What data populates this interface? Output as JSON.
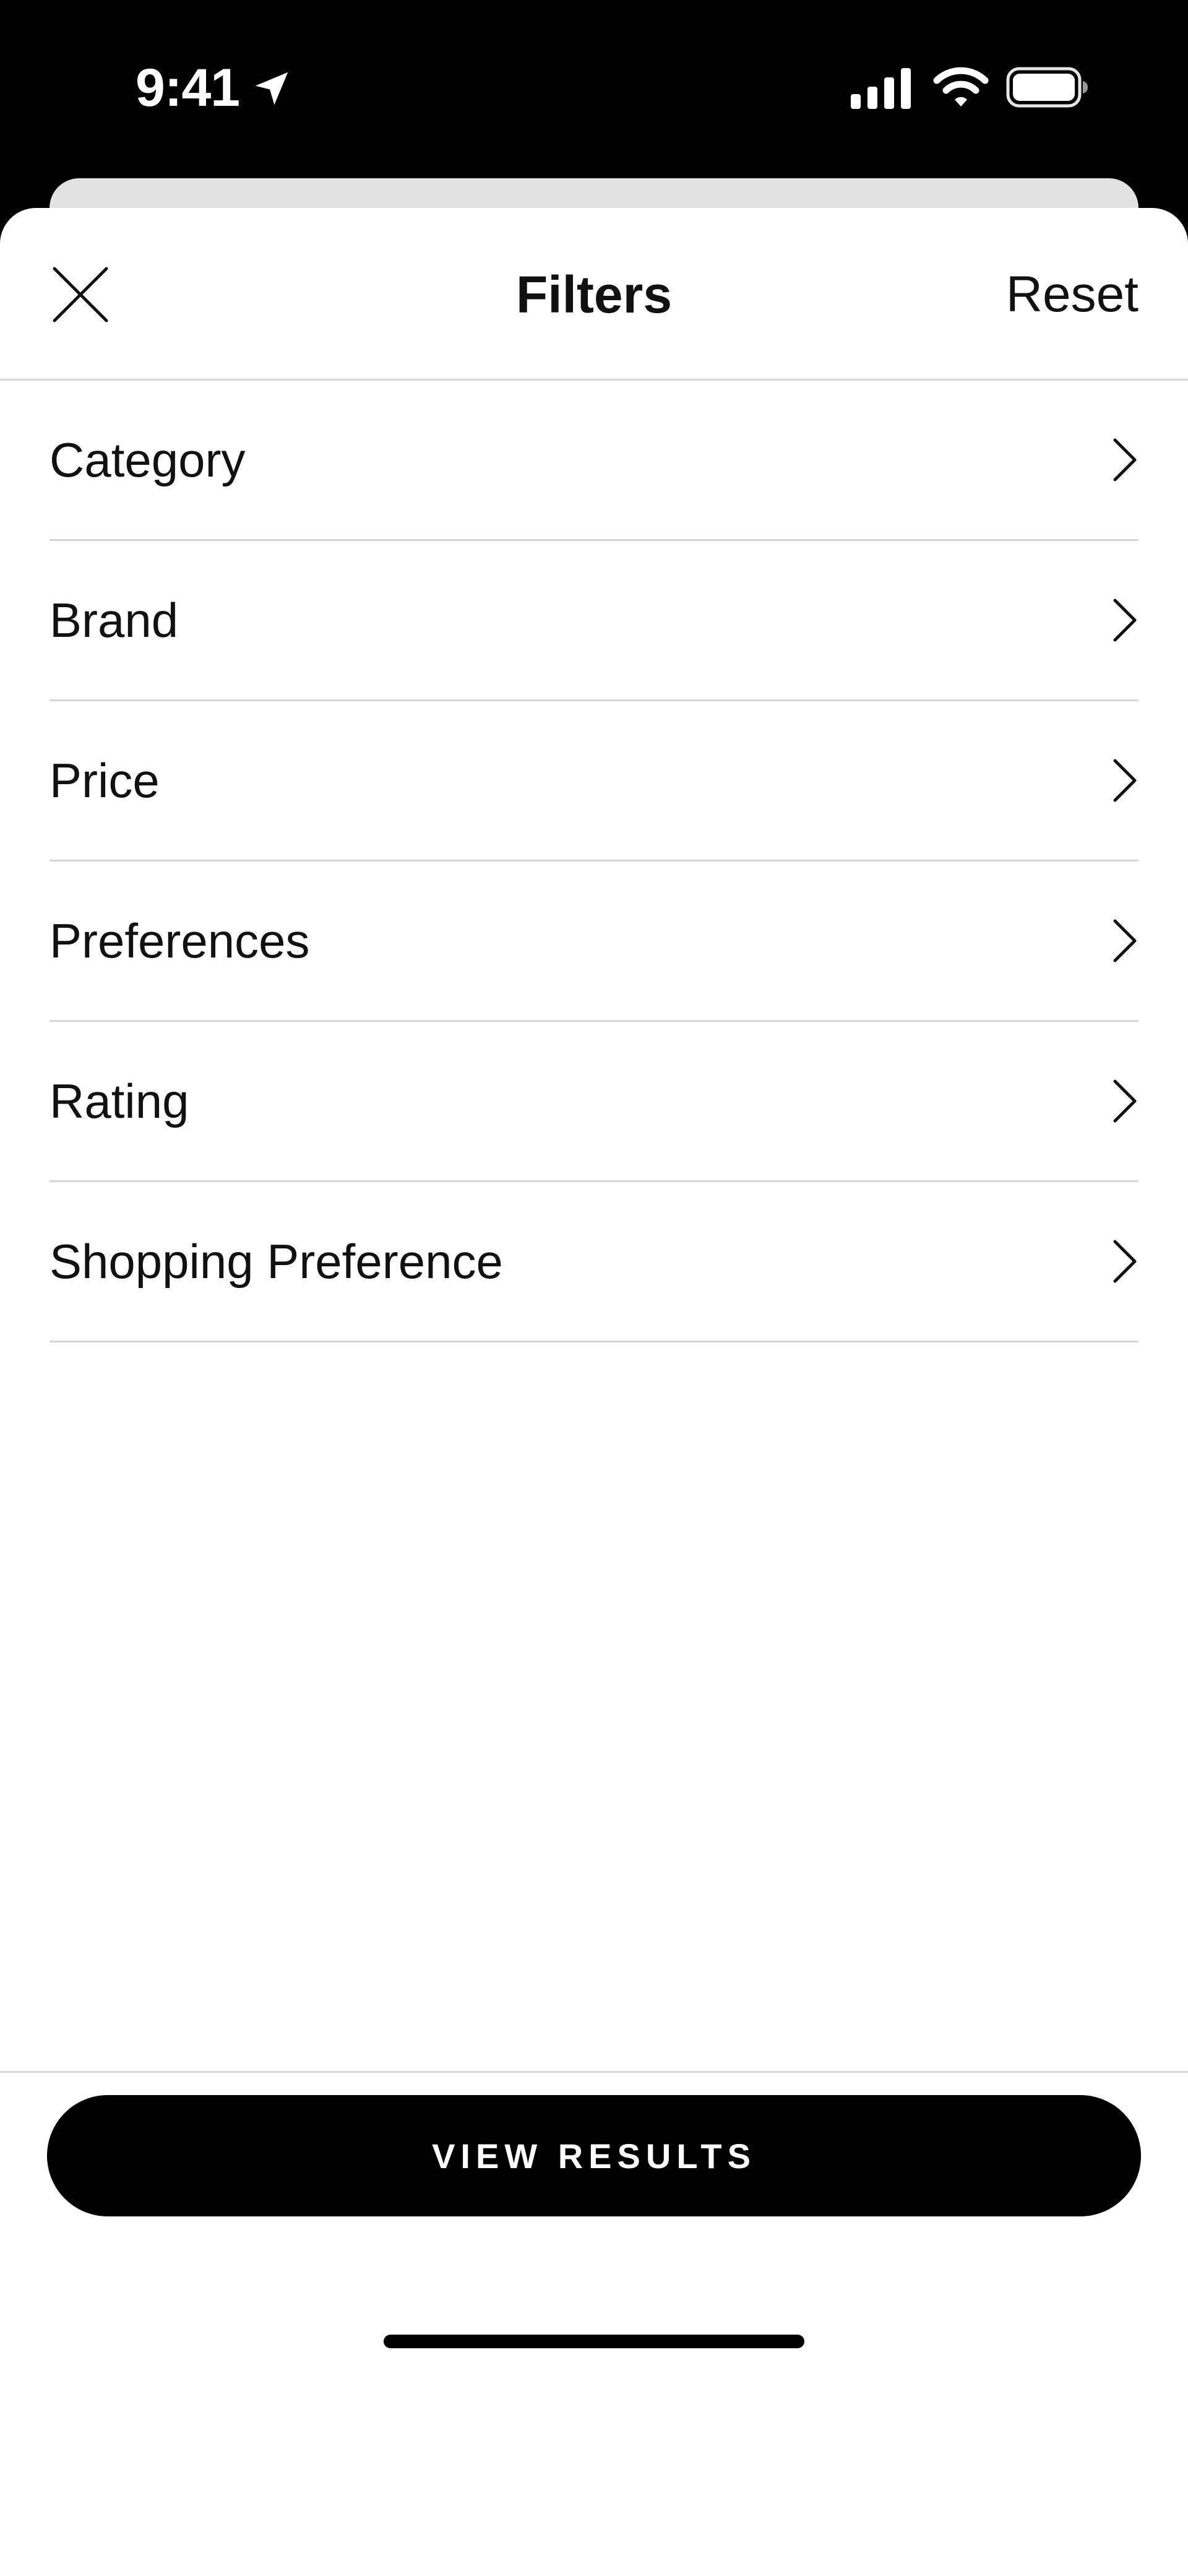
{
  "status_bar": {
    "time": "9:41",
    "icons": [
      "location-arrow-icon",
      "cellular-signal-icon",
      "wifi-icon",
      "battery-icon"
    ]
  },
  "header": {
    "close_icon": "close-icon",
    "title": "Filters",
    "reset_label": "Reset"
  },
  "filters": {
    "items": [
      {
        "label": "Category"
      },
      {
        "label": "Brand"
      },
      {
        "label": "Price"
      },
      {
        "label": "Preferences"
      },
      {
        "label": "Rating"
      },
      {
        "label": "Shopping Preference"
      }
    ],
    "chevron_icon": "chevron-right-icon"
  },
  "footer": {
    "view_results_label": "VIEW RESULTS"
  },
  "colors": {
    "background": "#ffffff",
    "status_bar": "#000000",
    "button": "#000000",
    "button_text": "#ffffff",
    "divider": "#d6d6d6",
    "text": "#111111"
  }
}
